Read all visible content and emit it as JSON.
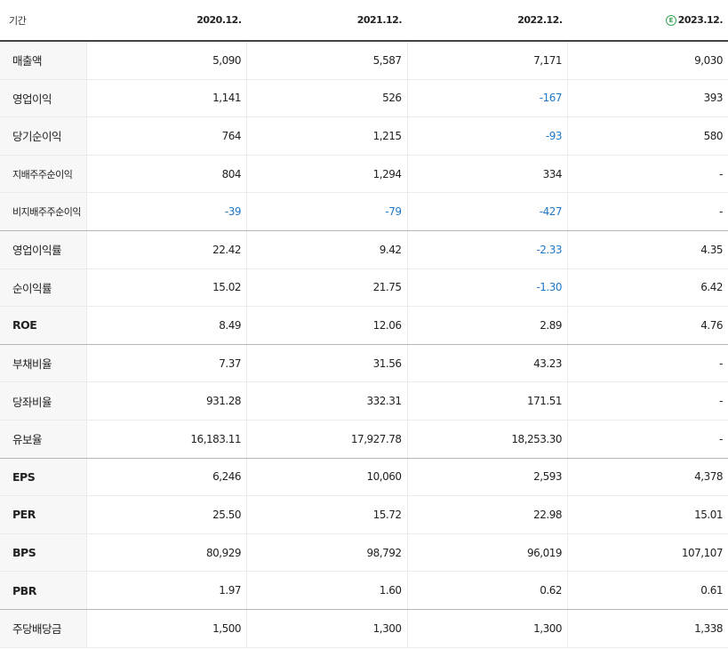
{
  "header": {
    "label": "기간",
    "periods": [
      "2020.12.",
      "2021.12.",
      "2022.12.",
      "2023.12."
    ],
    "estimate_mark": "E"
  },
  "rows": [
    {
      "label": "매출액",
      "values": [
        "5,090",
        "5,587",
        "7,171",
        "9,030"
      ]
    },
    {
      "label": "영업이익",
      "values": [
        "1,141",
        "526",
        "-167",
        "393"
      ]
    },
    {
      "label": "당기순이익",
      "values": [
        "764",
        "1,215",
        "-93",
        "580"
      ]
    },
    {
      "label": "지배주주순이익",
      "values": [
        "804",
        "1,294",
        "334",
        "-"
      ]
    },
    {
      "label": "비지배주주순이익",
      "values": [
        "-39",
        "-79",
        "-427",
        "-"
      ]
    },
    {
      "label": "영업이익률",
      "values": [
        "22.42",
        "9.42",
        "-2.33",
        "4.35"
      ]
    },
    {
      "label": "순이익률",
      "values": [
        "15.02",
        "21.75",
        "-1.30",
        "6.42"
      ]
    },
    {
      "label": "ROE",
      "values": [
        "8.49",
        "12.06",
        "2.89",
        "4.76"
      ]
    },
    {
      "label": "부채비율",
      "values": [
        "7.37",
        "31.56",
        "43.23",
        "-"
      ]
    },
    {
      "label": "당좌비율",
      "values": [
        "931.28",
        "332.31",
        "171.51",
        "-"
      ]
    },
    {
      "label": "유보율",
      "values": [
        "16,183.11",
        "17,927.78",
        "18,253.30",
        "-"
      ]
    },
    {
      "label": "EPS",
      "values": [
        "6,246",
        "10,060",
        "2,593",
        "4,378"
      ]
    },
    {
      "label": "PER",
      "values": [
        "25.50",
        "15.72",
        "22.98",
        "15.01"
      ]
    },
    {
      "label": "BPS",
      "values": [
        "80,929",
        "98,792",
        "96,019",
        "107,107"
      ]
    },
    {
      "label": "PBR",
      "values": [
        "1.97",
        "1.60",
        "0.62",
        "0.61"
      ]
    },
    {
      "label": "주당배당금",
      "values": [
        "1,500",
        "1,300",
        "1,300",
        "1,338"
      ]
    }
  ],
  "colors": {
    "negative": "#1f78c9",
    "estimate_badge": "#3aa655",
    "header_rule": "#444444"
  }
}
